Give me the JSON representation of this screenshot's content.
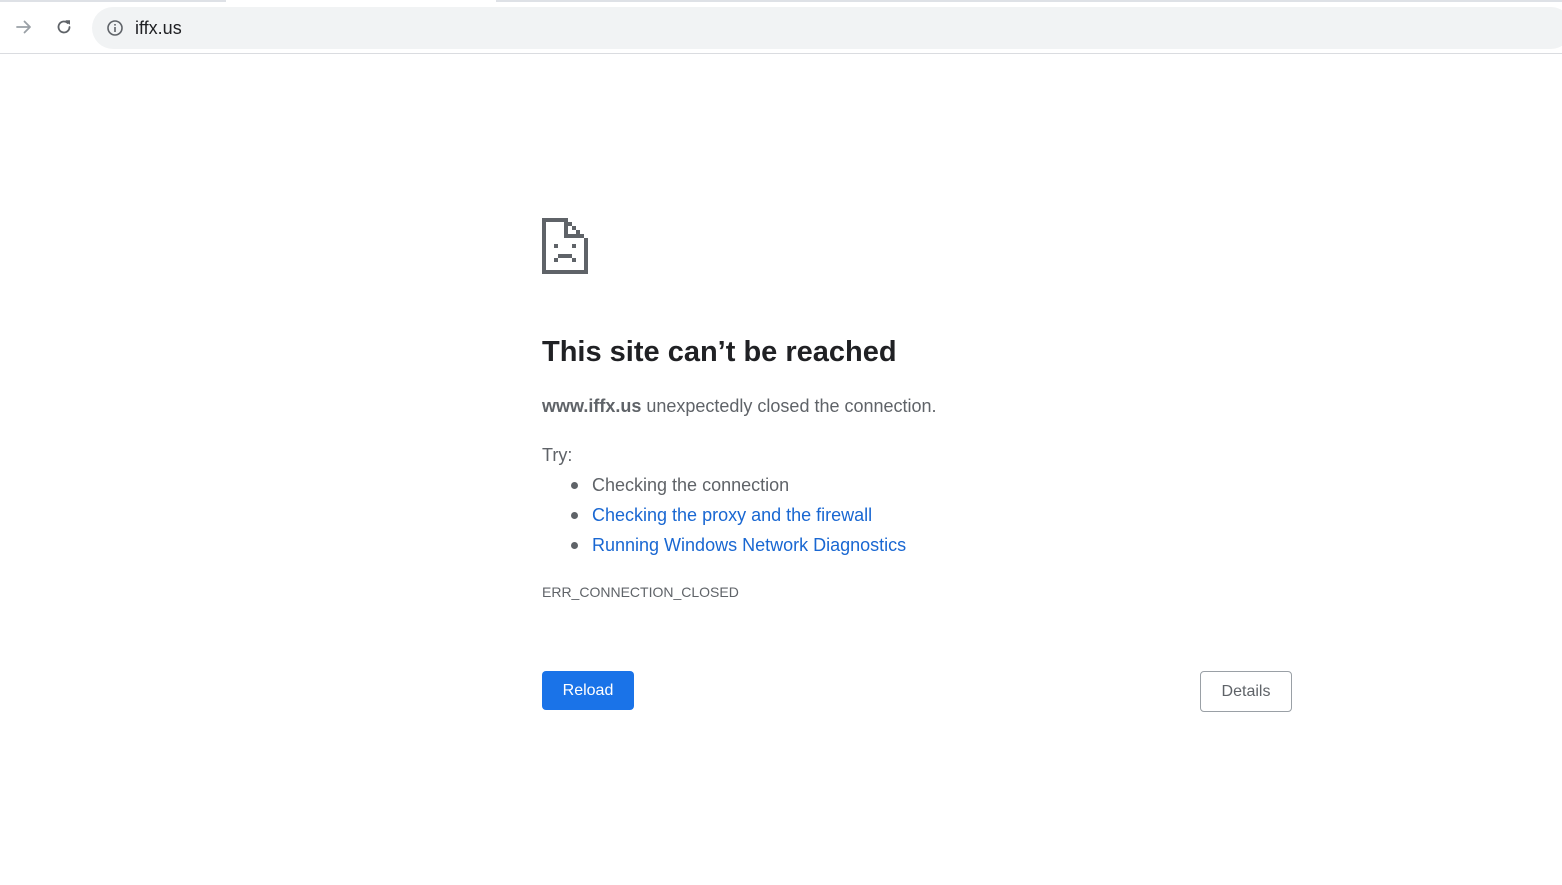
{
  "browser": {
    "address_bar": {
      "url": "iffx.us",
      "info_icon": "info-circle-icon"
    },
    "nav": {
      "forward_icon": "arrow-right-icon",
      "reload_icon": "reload-icon"
    }
  },
  "error_page": {
    "icon": "sad-page-icon",
    "title": "This site can’t be reached",
    "summary": {
      "host": "www.iffx.us",
      "message": " unexpectedly closed the connection."
    },
    "try_label": "Try:",
    "suggestions": [
      {
        "text": "Checking the connection",
        "link": false
      },
      {
        "text": "Checking the proxy and the firewall",
        "link": true
      },
      {
        "text": "Running Windows Network Diagnostics",
        "link": true
      }
    ],
    "error_code": "ERR_CONNECTION_CLOSED",
    "reload_label": "Reload",
    "details_label": "Details"
  },
  "colors": {
    "primary_button": "#1a73e8",
    "link": "#1967d2",
    "text_secondary": "#5f6368",
    "omnibox_bg": "#f1f3f4"
  }
}
